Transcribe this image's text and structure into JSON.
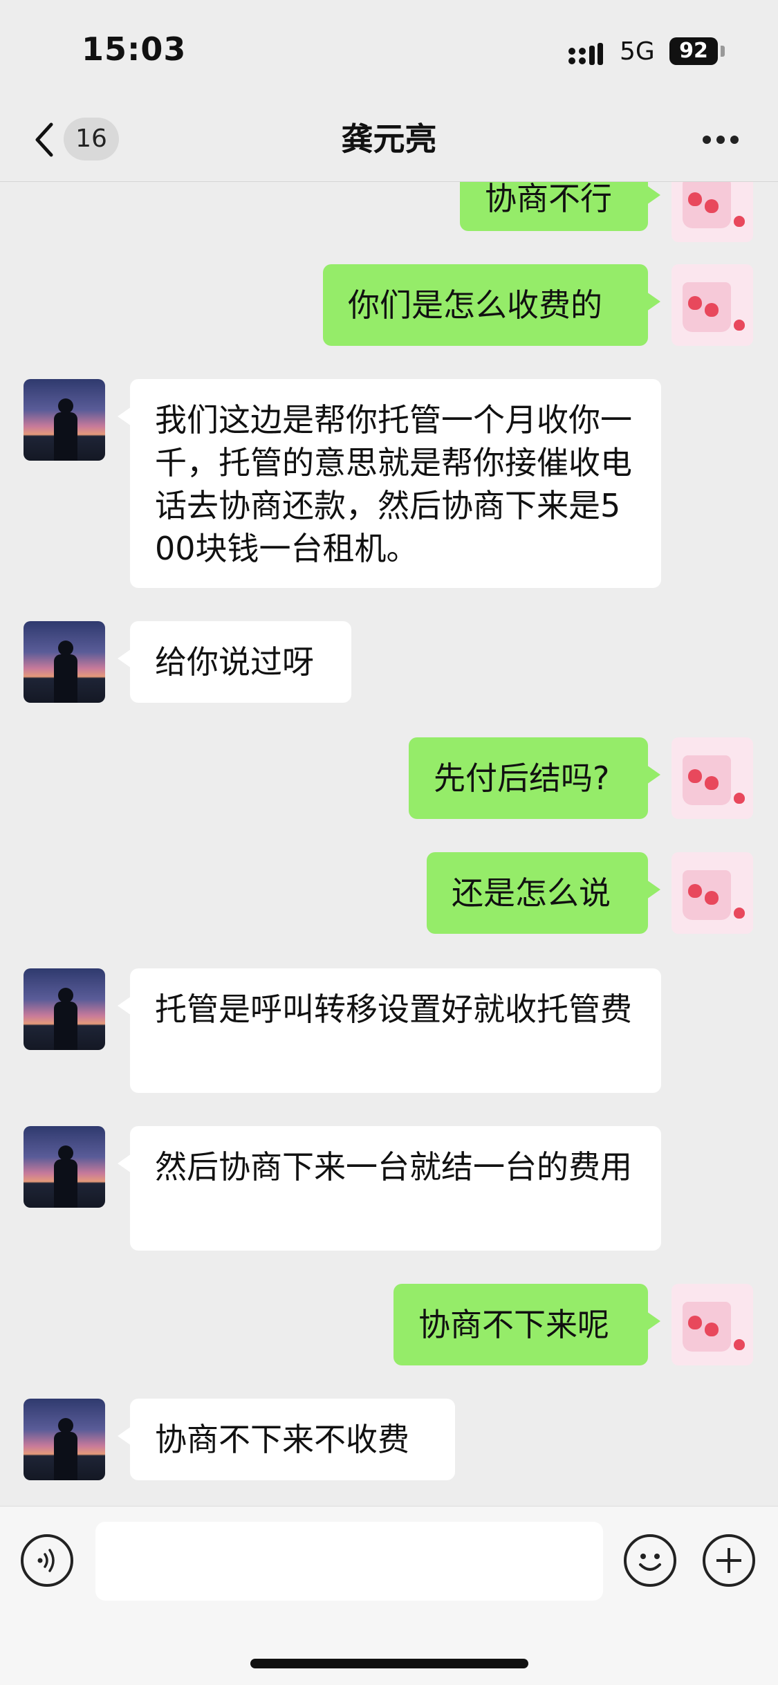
{
  "status_bar": {
    "time": "15:03",
    "network": "5G",
    "battery": "92"
  },
  "nav": {
    "unread_count": "16",
    "title": "龚元亮"
  },
  "messages": [
    {
      "sender": "self",
      "avatar": "strawberry-bag",
      "text": "协商不行"
    },
    {
      "sender": "self",
      "avatar": "strawberry-bag",
      "text": "你们是怎么收费的"
    },
    {
      "sender": "other",
      "avatar": "sunset-silhouette",
      "text": "我们这边是帮你托管一个月收你一千，托管的意思就是帮你接催收电话去协商还款，然后协商下来是500块钱一台租机。"
    },
    {
      "sender": "other",
      "avatar": "sunset-silhouette",
      "text": "给你说过呀"
    },
    {
      "sender": "self",
      "avatar": "strawberry-bag",
      "text": "先付后结吗?"
    },
    {
      "sender": "self",
      "avatar": "strawberry-bag",
      "text": "还是怎么说"
    },
    {
      "sender": "other",
      "avatar": "sunset-silhouette",
      "text": "托管是呼叫转移设置好就收托管费"
    },
    {
      "sender": "other",
      "avatar": "sunset-silhouette",
      "text": "然后协商下来一台就结一台的费用"
    },
    {
      "sender": "self",
      "avatar": "strawberry-bag",
      "text": "协商不下来呢"
    },
    {
      "sender": "other",
      "avatar": "sunset-silhouette",
      "text": "协商不下来不收费"
    }
  ],
  "input": {
    "value": "",
    "placeholder": ""
  },
  "colors": {
    "background": "#ededed",
    "self_bubble": "#95ec69",
    "other_bubble": "#ffffff"
  }
}
